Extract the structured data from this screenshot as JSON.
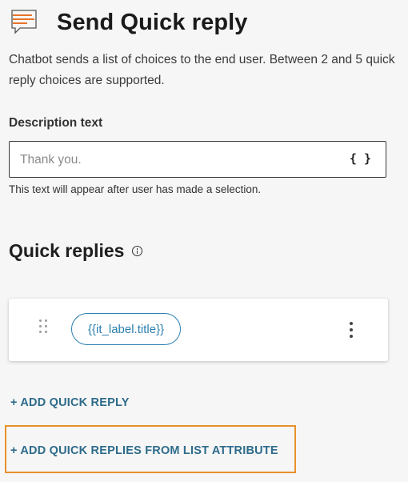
{
  "header": {
    "icon": "chat-bubble-lines-icon",
    "title": "Send Quick reply"
  },
  "description": "Chatbot sends a list of choices to the end user. Between 2 and 5 quick reply choices are supported.",
  "description_field": {
    "label": "Description text",
    "placeholder": "Thank you.",
    "value": "",
    "variable_button": "{ }",
    "helper_text": "This text will appear after user has made a selection."
  },
  "quick_replies": {
    "title": "Quick replies",
    "info_icon": "info-icon",
    "items": [
      {
        "label": "{{it_label.title}}"
      }
    ]
  },
  "actions": {
    "add_quick_reply": "+ ADD QUICK REPLY",
    "add_from_list": "+ ADD QUICK REPLIES FROM LIST ATTRIBUTE"
  },
  "colors": {
    "accent_orange": "#e8912d",
    "link_blue": "#2d6b8a",
    "chip_blue": "#2c7fb0",
    "background": "#f6f6f6"
  }
}
